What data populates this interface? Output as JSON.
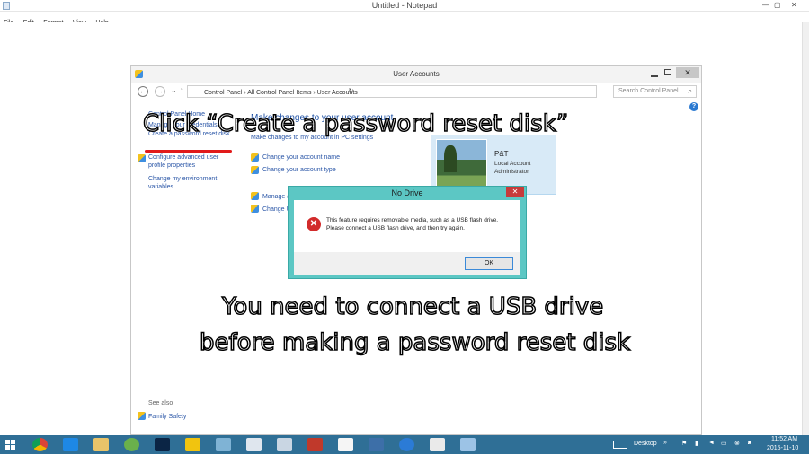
{
  "notepad": {
    "title": "Untitled - Notepad",
    "menu": [
      "File",
      "Edit",
      "Format",
      "View",
      "Help"
    ]
  },
  "window": {
    "title": "User Accounts",
    "address": "Control Panel  ›  All Control Panel Items  ›  User Accounts",
    "search_placeholder": "Search Control Panel"
  },
  "sidebar": {
    "items": [
      "Control Panel Home",
      "Manage your credentials",
      "Create a password reset disk",
      "Configure advanced user profile properties",
      "Change my environment variables"
    ],
    "see_also": "See also",
    "family_safety": "Family Safety"
  },
  "main": {
    "heading": "Make changes to your user account",
    "links": [
      "Make changes to my account in PC settings",
      "Change your account name",
      "Change your account type",
      "Manage another account",
      "Change User Account Control settings"
    ]
  },
  "user": {
    "name": "P&T",
    "line1": "Local Account",
    "line2": "Administrator"
  },
  "dialog": {
    "title": "No Drive",
    "close": "✕",
    "message_line1": "This feature requires removable media, such as a USB flash drive.",
    "message_line2": "Please connect a USB flash drive, and then try again.",
    "ok": "OK"
  },
  "overlay": {
    "instruction": "Click “Create a password reset disk”",
    "note_line1": "You need to connect a USB drive",
    "note_line2": "before making a password reset disk"
  },
  "taskbar": {
    "desktop_label": "Desktop",
    "time": "11:52 AM",
    "date": "2015-11-10"
  }
}
